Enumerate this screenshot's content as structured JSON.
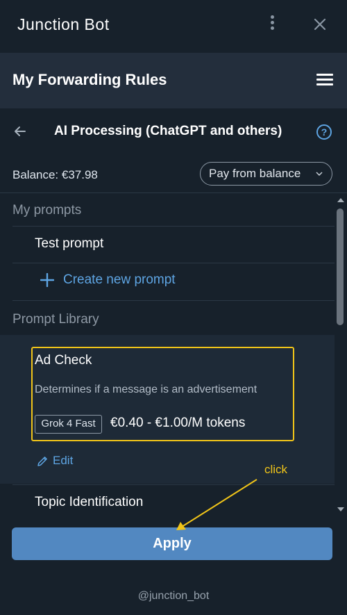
{
  "window": {
    "title": "Junction Bot"
  },
  "header": {
    "title": "My Forwarding Rules"
  },
  "subheader": {
    "title": "AI Processing (ChatGPT and others)",
    "help": "?"
  },
  "balance": {
    "label": "Balance: €37.98"
  },
  "payment": {
    "selected": "Pay from balance"
  },
  "my_prompts": {
    "label": "My prompts",
    "items": [
      {
        "label": "Test prompt"
      }
    ],
    "create_label": "Create new prompt"
  },
  "library": {
    "label": "Prompt Library",
    "items": [
      {
        "title": "Ad Check",
        "description": "Determines if a message is an advertisement",
        "model": "Grok 4 Fast",
        "price": "€0.40 - €1.00/M tokens",
        "edit_label": "Edit"
      },
      {
        "title": "Topic Identification"
      }
    ]
  },
  "apply": {
    "label": "Apply"
  },
  "annotation": {
    "label": "click"
  },
  "footer": {
    "handle": "@junction_bot"
  },
  "colors": {
    "background": "#17212b",
    "header": "#232e3c",
    "accent": "#5ea5e3",
    "button": "#5288c1",
    "highlight": "#f0c419"
  },
  "icons": [
    "more-vertical-icon",
    "close-icon",
    "menu-icon",
    "back-arrow-icon",
    "help-icon",
    "chevron-down-icon",
    "plus-icon",
    "pencil-icon"
  ]
}
